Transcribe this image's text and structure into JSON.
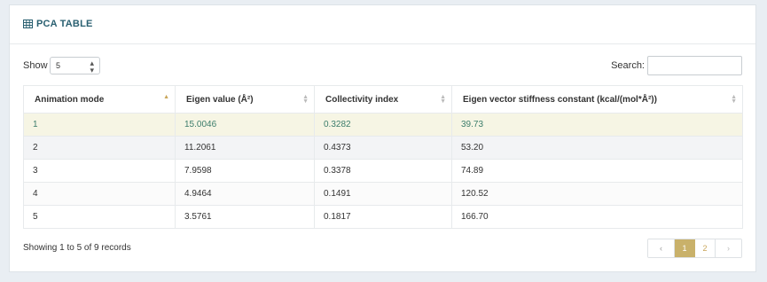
{
  "panel": {
    "title": "PCA TABLE",
    "title_icon": "table-icon"
  },
  "controls": {
    "show_label": "Show",
    "show_value": "5",
    "search_label": "Search:",
    "search_value": ""
  },
  "table": {
    "headers": [
      "Animation mode",
      "Eigen value (Å²)",
      "Collectivity index",
      "Eigen vector stiffness constant (kcal/(mol*Å²))"
    ],
    "sorted_column": 0,
    "rows": [
      [
        "1",
        "15.0046",
        "0.3282",
        "39.73"
      ],
      [
        "2",
        "11.2061",
        "0.4373",
        "53.20"
      ],
      [
        "3",
        "7.9598",
        "0.3378",
        "74.89"
      ],
      [
        "4",
        "4.9464",
        "0.1491",
        "120.52"
      ],
      [
        "5",
        "3.5761",
        "0.1817",
        "166.70"
      ]
    ]
  },
  "footer": {
    "info": "Showing 1 to 5 of 9 records"
  },
  "pagination": {
    "prev": "‹",
    "pages": [
      "1",
      "2"
    ],
    "current": "1",
    "next": "›"
  },
  "colors": {
    "accent": "#c9b16a",
    "title": "#2a6071",
    "highlight_row": "#f6f5e4",
    "highlight_text": "#3c7d6b"
  }
}
